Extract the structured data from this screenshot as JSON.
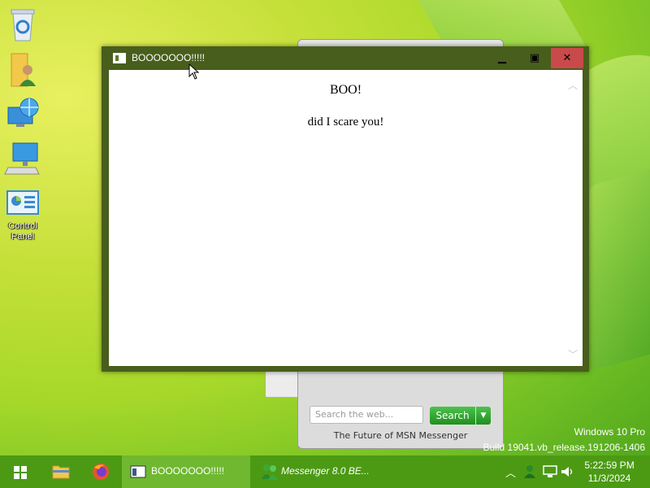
{
  "desktop": {
    "icons": [
      {
        "name": "Recycle Bin",
        "label": ""
      },
      {
        "name": "User Files",
        "label": ""
      },
      {
        "name": "Network",
        "label": ""
      },
      {
        "name": "This PC",
        "label": ""
      },
      {
        "name": "Control Panel",
        "label": "Control Panel"
      }
    ]
  },
  "window": {
    "title": "BOOOOOOO!!!!!",
    "heading": "BOO!",
    "message": "did I scare you!"
  },
  "messenger": {
    "search_placeholder": "Search the web...",
    "search_button": "Search",
    "footer": "The Future of MSN Messenger"
  },
  "taskbar": {
    "tasks": [
      {
        "label": "BOOOOOOO!!!!!",
        "active": true
      },
      {
        "label": "Messenger 8.0 BE...",
        "active": false
      }
    ],
    "clock": {
      "time": "5:22:59 PM",
      "date": "11/3/2024"
    }
  },
  "watermark": {
    "line1": "Windows 10 Pro",
    "line2": "Build 19041.vb_release.191206-1406"
  },
  "colors": {
    "window_frame": "#485e1c",
    "taskbar": "#4c9a14",
    "close_button": "#c84a4a"
  }
}
